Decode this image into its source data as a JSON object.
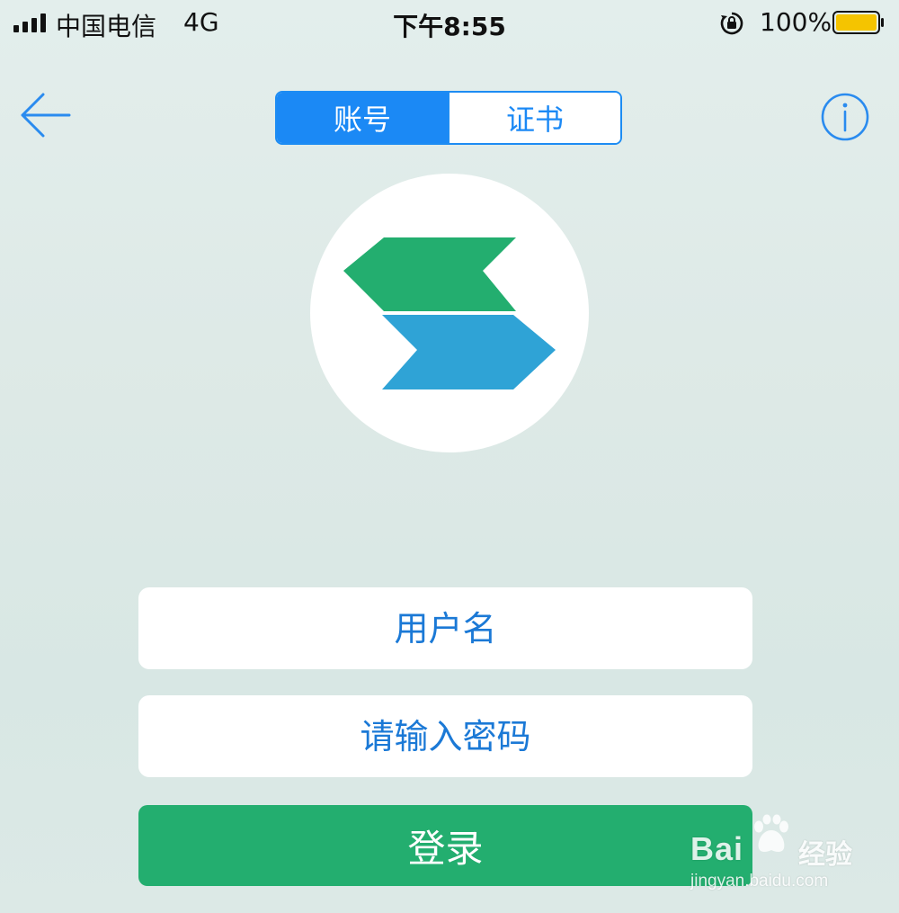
{
  "status_bar": {
    "carrier": "中国电信",
    "network": "4G",
    "time": "下午8:55",
    "battery_percent": "100%",
    "battery_level": 1.0,
    "icons": [
      "signal-icon",
      "orientation-lock-icon",
      "battery-icon"
    ]
  },
  "nav": {
    "back_icon": "arrow-left-icon",
    "info_icon": "info-circle-icon",
    "tabs": [
      {
        "label": "账号",
        "selected": true
      },
      {
        "label": "证书",
        "selected": false
      }
    ]
  },
  "logo": {
    "icon": "app-logo-icon",
    "colors": [
      "#23ae6f",
      "#2fa3d6"
    ]
  },
  "form": {
    "username_placeholder": "用户名",
    "username_value": "",
    "password_placeholder": "请输入密码",
    "password_value": "",
    "login_label": "登录"
  },
  "watermark": {
    "brand": "Bai",
    "brand_cn": "经验",
    "url": "jingyan.baidu.com"
  },
  "colors": {
    "accent": "#1b89f5",
    "login_button": "#23ae6f",
    "field_text": "#1b79d6"
  }
}
